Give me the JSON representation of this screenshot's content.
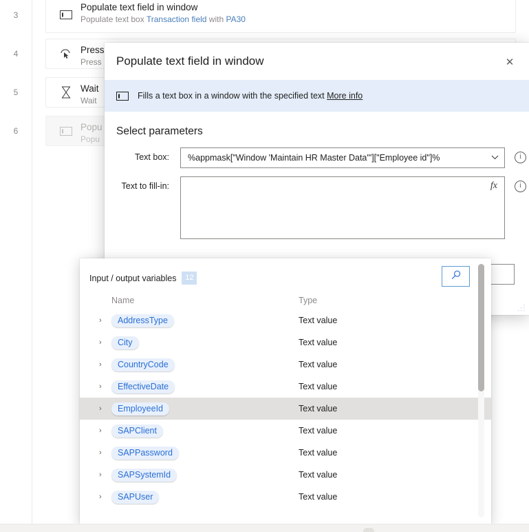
{
  "flow": {
    "steps": [
      {
        "number": "3",
        "icon": "text-field-icon",
        "title": "Populate text field in window",
        "sub_pre": "Populate text box ",
        "sub_link1": "Transaction field",
        "sub_mid": " with ",
        "sub_link2": "PA30",
        "disabled": false
      },
      {
        "number": "4",
        "icon": "press-button-icon",
        "title": "Press",
        "sub_pre": "Press",
        "sub_link1": "",
        "sub_mid": "",
        "sub_link2": "",
        "disabled": false
      },
      {
        "number": "5",
        "icon": "hourglass-icon",
        "title": "Wait",
        "sub_pre": "Wait ",
        "sub_link1": "",
        "sub_mid": "",
        "sub_link2": "",
        "disabled": false
      },
      {
        "number": "6",
        "icon": "text-field-icon",
        "title": "Popu",
        "sub_pre": "Popu",
        "sub_link1": "",
        "sub_mid": "",
        "sub_link2": "",
        "disabled": true
      }
    ]
  },
  "dialog": {
    "title": "Populate text field in window",
    "close_label": "✕",
    "banner": {
      "icon": "text-field-icon",
      "text": "Fills a text box in a window with the specified text ",
      "link": "More info"
    },
    "section_title": "Select parameters",
    "fields": {
      "textbox_label": "Text box:",
      "textbox_value": "%appmask[\"Window 'Maintain HR Master Data'\"][\"Employee id\"]%",
      "chevron": "⌄",
      "info": "i",
      "text_fill_label": "Text to fill-in:",
      "text_fill_value": "",
      "fx_label": "fx"
    }
  },
  "variables_panel": {
    "title": "Input / output variables",
    "count": "12",
    "search_icon": "search-icon",
    "columns": {
      "name": "Name",
      "type": "Type"
    },
    "rows": [
      {
        "name": "AddressType",
        "type": "Text value",
        "selected": false
      },
      {
        "name": "City",
        "type": "Text value",
        "selected": false
      },
      {
        "name": "CountryCode",
        "type": "Text value",
        "selected": false
      },
      {
        "name": "EffectiveDate",
        "type": "Text value",
        "selected": false
      },
      {
        "name": "EmployeeId",
        "type": "Text value",
        "selected": true
      },
      {
        "name": "SAPClient",
        "type": "Text value",
        "selected": false
      },
      {
        "name": "SAPPassword",
        "type": "Text value",
        "selected": false
      },
      {
        "name": "SAPSystemId",
        "type": "Text value",
        "selected": false
      },
      {
        "name": "SAPUser",
        "type": "Text value",
        "selected": false
      }
    ],
    "expand_chevron": "›"
  },
  "colors": {
    "accent_blue": "#2b6fd4",
    "banner_bg": "#e4edf9",
    "pill_bg": "#e8f0fc",
    "selected_row": "#e2e0de",
    "search_border": "#5b9bd5"
  }
}
